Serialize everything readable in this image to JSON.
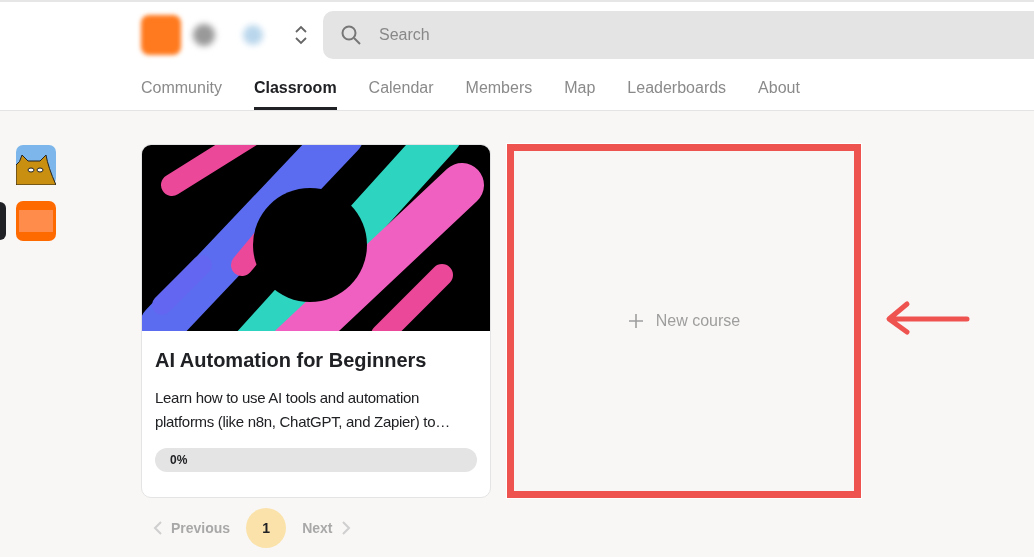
{
  "header": {
    "search": {
      "placeholder": "Search"
    }
  },
  "tabs": [
    {
      "label": "Community",
      "selected": false
    },
    {
      "label": "Classroom",
      "selected": true
    },
    {
      "label": "Calendar",
      "selected": false
    },
    {
      "label": "Members",
      "selected": false
    },
    {
      "label": "Map",
      "selected": false
    },
    {
      "label": "Leaderboards",
      "selected": false
    },
    {
      "label": "About",
      "selected": false
    }
  ],
  "sidebar": {
    "items": [
      {
        "kind": "cat",
        "selected": false
      },
      {
        "kind": "orange",
        "selected": true
      }
    ]
  },
  "courses": [
    {
      "kind": "course",
      "title": "AI Automation for Beginners",
      "description": "Learn how to use AI tools and automation platforms (like n8n, ChatGPT, and Zapier) to…",
      "progress_label": "0%",
      "level": 0
    },
    {
      "kind": "new",
      "label": "New course",
      "highlighted": true
    }
  ],
  "pagination": {
    "previous": "Previous",
    "next": "Next",
    "pages": [
      {
        "label": "1",
        "selected": true
      }
    ]
  }
}
